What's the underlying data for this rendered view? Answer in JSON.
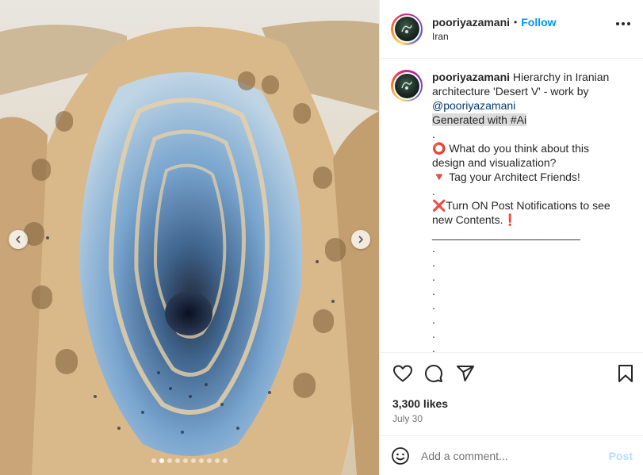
{
  "post": {
    "username": "pooriyazamani",
    "follow_label": "Follow",
    "separator": "•",
    "location": "Iran",
    "media": {
      "alt": "AI-generated desert architecture with blue mosaic spiral",
      "slide_count": 10,
      "active_slide": 1
    },
    "caption": {
      "username": "pooriyazamani",
      "intro": " Hierarchy in Iranian architecture 'Desert V' - work by ",
      "mention": "@pooriyazamani",
      "generated": "Generated with #Ai",
      "lines": [
        ".",
        "⭕ What do you think about this design and visualization?",
        "🔻 Tag your Architect Friends!",
        ".",
        "❌Turn ON Post Notifications to see new Contents.❗",
        "________________________",
        ".",
        ".",
        ".",
        ".",
        ".",
        ".",
        ".",
        "."
      ]
    },
    "likes": "3,300 likes",
    "date": "July 30",
    "comment": {
      "placeholder": "Add a comment...",
      "value": "",
      "post_label": "Post"
    },
    "icons": {
      "more": "more-options-icon",
      "like": "heart-icon",
      "comment": "comment-icon",
      "share": "share-icon",
      "save": "bookmark-icon",
      "emoji": "emoji-icon",
      "prev": "chevron-left-icon",
      "next": "chevron-right-icon"
    },
    "colors": {
      "link": "#0095f6",
      "mention": "#00376b",
      "post_disabled": "#b2dffc"
    }
  }
}
